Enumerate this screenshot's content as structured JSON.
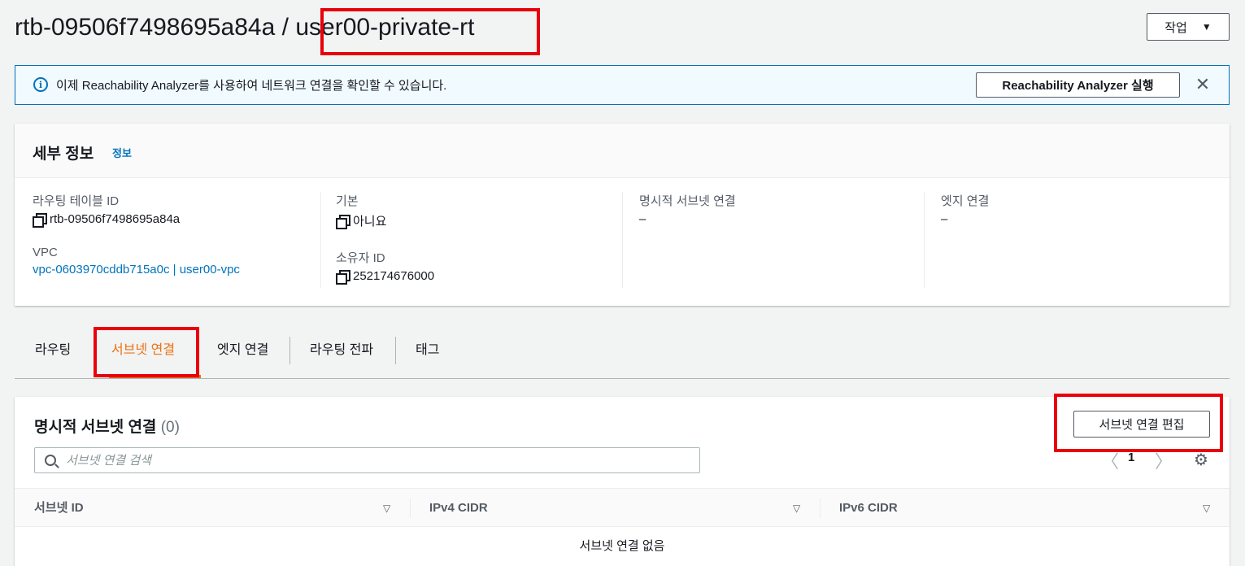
{
  "header": {
    "route_table_id": "rtb-09506f7498695a84a",
    "separator": "/",
    "route_table_name": "user00-private-rt",
    "actions_label": "작업",
    "actions_caret": "▼"
  },
  "banner": {
    "text": "이제 Reachability Analyzer를 사용하여 네트워크 연결을 확인할 수 있습니다.",
    "button_label": "Reachability Analyzer 실행",
    "close_glyph": "✕",
    "info_glyph": "i"
  },
  "details": {
    "title": "세부 정보",
    "info_link": "정보",
    "fields": {
      "route_table_id_label": "라우팅 테이블 ID",
      "route_table_id_value": "rtb-09506f7498695a84a",
      "vpc_label": "VPC",
      "vpc_value": "vpc-0603970cddb715a0c | user00-vpc",
      "main_label": "기본",
      "main_value": "아니요",
      "owner_label": "소유자 ID",
      "owner_value": "252174676000",
      "explicit_subnet_label": "명시적 서브넷 연결",
      "explicit_subnet_value": "–",
      "edge_label": "엣지 연결",
      "edge_value": "–"
    }
  },
  "tabs": [
    {
      "label": "라우팅",
      "active": false
    },
    {
      "label": "서브넷 연결",
      "active": true
    },
    {
      "label": "엣지 연결",
      "active": false
    },
    {
      "label": "라우팅 전파",
      "active": false
    },
    {
      "label": "태그",
      "active": false
    }
  ],
  "subnet_assoc": {
    "title": "명시적 서브넷 연결",
    "count": "(0)",
    "edit_button": "서브넷 연결 편집",
    "search_placeholder": "서브넷 연결 검색",
    "page_number": "1",
    "prev_glyph": "〈",
    "next_glyph": "〉",
    "settings_glyph": "⚙",
    "columns": [
      "서브넷 ID",
      "IPv4 CIDR",
      "IPv6 CIDR"
    ],
    "sort_glyph": "▽",
    "empty_message": "서브넷 연결 없음"
  },
  "colors": {
    "accent_tab": "#ec7211",
    "link": "#0073bb",
    "highlight_box": "#e8000b"
  }
}
